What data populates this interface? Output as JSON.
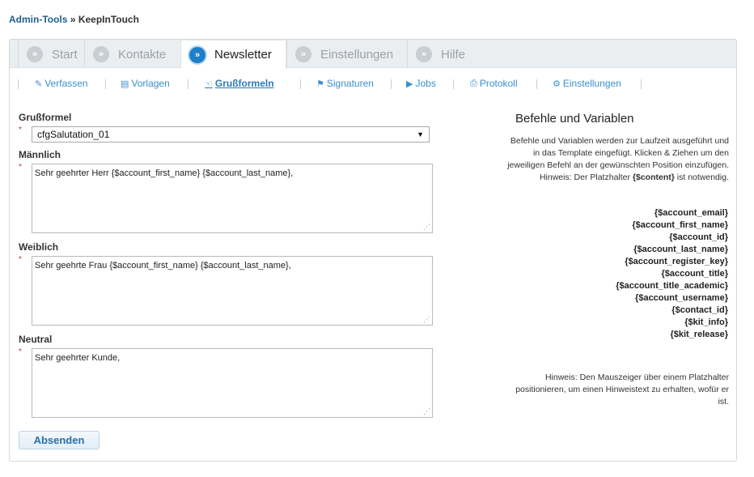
{
  "breadcrumb": {
    "root": "Admin-Tools",
    "separator": "»",
    "current": "KeepInTouch"
  },
  "tabs": [
    {
      "label": "Start",
      "active": false
    },
    {
      "label": "Kontakte",
      "active": false
    },
    {
      "label": "Newsletter",
      "active": true
    },
    {
      "label": "Einstellungen",
      "active": false
    },
    {
      "label": "Hilfe",
      "active": false
    }
  ],
  "tab_bullet": "»",
  "subnav": [
    {
      "label": "Verfassen",
      "icon": "edit-icon"
    },
    {
      "label": "Vorlagen",
      "icon": "template-icon"
    },
    {
      "label": "Grußformeln",
      "icon": "hand-icon",
      "active": true
    },
    {
      "label": "Signaturen",
      "icon": "bookmark-icon"
    },
    {
      "label": "Jobs",
      "icon": "play-icon"
    },
    {
      "label": "Protokoll",
      "icon": "print-icon"
    },
    {
      "label": "Einstellungen",
      "icon": "gears-icon"
    }
  ],
  "form": {
    "salutation_label": "Grußformel",
    "salutation_value": "cfgSalutation_01",
    "male_label": "Männlich",
    "male_value": "Sehr geehrter Herr {$account_first_name} {$account_last_name},",
    "female_label": "Weiblich",
    "female_value": "Sehr geehrte Frau {$account_first_name} {$account_last_name},",
    "neutral_label": "Neutral",
    "neutral_value": "Sehr geehrter Kunde,",
    "required_mark": "*",
    "submit_label": "Absenden"
  },
  "sidebar": {
    "title": "Befehle und Variablen",
    "description_1": "Befehle und Variablen werden zur Laufzeit ausgeführt und in das Template eingefügt. Klicken & Ziehen um den jeweiligen Befehl an der gewünschten Position einzufügen. Hinweis: Der Platzhalter",
    "description_bold": "{$content}",
    "description_2": "ist notwendig.",
    "variables": [
      "{$account_email}",
      "{$account_first_name}",
      "{$account_id}",
      "{$account_last_name}",
      "{$account_register_key}",
      "{$account_title}",
      "{$account_title_academic}",
      "{$account_username}",
      "{$contact_id}",
      "{$kit_info}",
      "{$kit_release}"
    ],
    "hint": "Hinweis: Den Mauszeiger über einem Platzhalter positionieren, um einen Hinweistext zu erhalten, wofür er ist."
  },
  "colors": {
    "accent": "#1d7fc7",
    "link": "#3b8fcf",
    "required": "#c0392b"
  }
}
